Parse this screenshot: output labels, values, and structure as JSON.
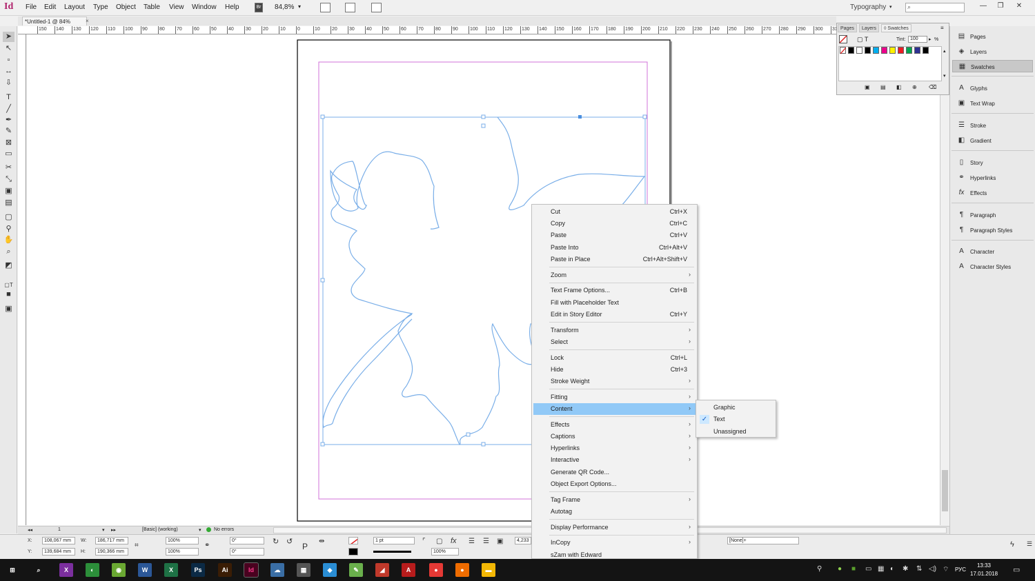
{
  "app": {
    "logo": "Id",
    "menu": [
      "File",
      "Edit",
      "Layout",
      "Type",
      "Object",
      "Table",
      "View",
      "Window",
      "Help"
    ],
    "bridge_label": "Br",
    "zoom": "84,8%",
    "workspace": "Typography",
    "window_controls": [
      "—",
      "❐",
      "✕"
    ]
  },
  "document": {
    "tab_title": "*Untitled-1 @ 84%",
    "tab_close": "×"
  },
  "ruler_top_labels": [
    "150",
    "140",
    "130",
    "120",
    "110",
    "100",
    "90",
    "80",
    "70",
    "60",
    "50",
    "40",
    "30",
    "20",
    "10",
    "0",
    "10",
    "20",
    "30",
    "40",
    "50",
    "60",
    "70",
    "80",
    "90",
    "100",
    "110",
    "120",
    "130",
    "140",
    "150",
    "160",
    "170",
    "180",
    "190",
    "200",
    "210",
    "220",
    "230",
    "240",
    "250",
    "260",
    "270",
    "280",
    "290",
    "300",
    "310"
  ],
  "swatches_panel": {
    "tabs": [
      "Pages",
      "Layers",
      "◊ Swatches"
    ],
    "tint_label": "Tint:",
    "tint_value": "100",
    "tint_unit": "%",
    "swatch_colors": [
      "#ffffff",
      "#000000",
      "#ffffff",
      "#000000",
      "#00aeef",
      "#ec008c",
      "#fff200",
      "#ed1c24",
      "#00a651",
      "#2e3192",
      "#000000"
    ],
    "footer_icons": [
      "new-group-icon",
      "show-all-icon",
      "new-swatch-icon",
      "duplicate-icon",
      "delete-icon"
    ]
  },
  "right_dock": {
    "items": [
      {
        "label": "Pages",
        "icon": "▤"
      },
      {
        "label": "Layers",
        "icon": "◈"
      },
      {
        "label": "Swatches",
        "icon": "▦",
        "active": true
      },
      {
        "label": "Glyphs",
        "icon": "A"
      },
      {
        "label": "Text Wrap",
        "icon": "▣"
      },
      {
        "label": "Stroke",
        "icon": "☰"
      },
      {
        "label": "Gradient",
        "icon": "◧"
      },
      {
        "label": "Story",
        "icon": "▯"
      },
      {
        "label": "Hyperlinks",
        "icon": "⚭"
      },
      {
        "label": "Effects",
        "icon": "fx"
      },
      {
        "label": "Paragraph",
        "icon": "¶"
      },
      {
        "label": "Paragraph Styles",
        "icon": "¶"
      },
      {
        "label": "Character",
        "icon": "A"
      },
      {
        "label": "Character Styles",
        "icon": "A"
      }
    ]
  },
  "context_menu": {
    "items": [
      {
        "label": "Cut",
        "shortcut": "Ctrl+X"
      },
      {
        "label": "Copy",
        "shortcut": "Ctrl+C"
      },
      {
        "label": "Paste",
        "shortcut": "Ctrl+V"
      },
      {
        "label": "Paste Into",
        "shortcut": "Ctrl+Alt+V"
      },
      {
        "label": "Paste in Place",
        "shortcut": "Ctrl+Alt+Shift+V"
      },
      {
        "label": "Zoom",
        "submenu": true
      },
      {
        "label": "Text Frame Options...",
        "shortcut": "Ctrl+B"
      },
      {
        "label": "Fill with Placeholder Text"
      },
      {
        "label": "Edit in Story Editor",
        "shortcut": "Ctrl+Y"
      },
      {
        "label": "Transform",
        "submenu": true
      },
      {
        "label": "Select",
        "submenu": true
      },
      {
        "label": "Lock",
        "shortcut": "Ctrl+L"
      },
      {
        "label": "Hide",
        "shortcut": "Ctrl+3"
      },
      {
        "label": "Stroke Weight",
        "submenu": true
      },
      {
        "label": "Fitting",
        "submenu": true
      },
      {
        "label": "Content",
        "submenu": true,
        "highlighted": true
      },
      {
        "label": "Effects",
        "submenu": true
      },
      {
        "label": "Captions",
        "submenu": true
      },
      {
        "label": "Hyperlinks",
        "submenu": true
      },
      {
        "label": "Interactive",
        "submenu": true
      },
      {
        "label": "Generate QR Code..."
      },
      {
        "label": "Object Export Options..."
      },
      {
        "label": "Tag Frame",
        "submenu": true
      },
      {
        "label": "Autotag"
      },
      {
        "label": "Display Performance",
        "submenu": true
      },
      {
        "label": "InCopy",
        "submenu": true
      },
      {
        "label": "sZam with Edward"
      }
    ],
    "arrow": "›"
  },
  "content_submenu": {
    "items": [
      {
        "label": "Graphic",
        "checked": false
      },
      {
        "label": "Text",
        "checked": true
      },
      {
        "label": "Unassigned",
        "checked": false
      }
    ],
    "check": "✓"
  },
  "control_panel": {
    "x_label": "X:",
    "x_value": "108,067 mm",
    "y_label": "Y:",
    "y_value": "139,684 mm",
    "w_label": "W:",
    "w_value": "186,717 mm",
    "h_label": "H:",
    "h_value": "190,366 mm",
    "scale_x": "100%",
    "scale_y": "100%",
    "rotate": "0°",
    "shear": "0°",
    "stroke_weight": "1 pt",
    "opacity": "100%",
    "gutter_value": "4,233",
    "object_style": "[None]+"
  },
  "status_bar": {
    "page": "1",
    "preflight_profile": "[Basic] (working)",
    "preflight_status": "No errors"
  },
  "taskbar": {
    "apps": [
      {
        "name": "windows-start-icon",
        "label": "⊞",
        "color": "#141414"
      },
      {
        "name": "search-icon",
        "label": "⌕",
        "color": "#141414"
      },
      {
        "name": "app-icon-1",
        "label": "X",
        "color": "#7b2f9e"
      },
      {
        "name": "app-icon-2",
        "label": "◐",
        "color": "#2c8f3a"
      },
      {
        "name": "app-icon-3",
        "label": "◉",
        "color": "#6aa832"
      },
      {
        "name": "word-icon",
        "label": "W",
        "color": "#2b5797"
      },
      {
        "name": "excel-icon",
        "label": "X",
        "color": "#1e7145"
      },
      {
        "name": "photoshop-icon",
        "label": "Ps",
        "color": "#0b2a45"
      },
      {
        "name": "illustrator-icon",
        "label": "Ai",
        "color": "#3a1d05"
      },
      {
        "name": "indesign-icon",
        "label": "Id",
        "color": "#49021f"
      },
      {
        "name": "app-icon-4",
        "label": "☁",
        "color": "#3a6ea5"
      },
      {
        "name": "calculator-icon",
        "label": "▦",
        "color": "#555555"
      },
      {
        "name": "app-icon-5",
        "label": "◆",
        "color": "#2a8dd4"
      },
      {
        "name": "app-icon-6",
        "label": "✎",
        "color": "#6ab04c"
      },
      {
        "name": "pdf-icon",
        "label": "◢",
        "color": "#c0392b"
      },
      {
        "name": "acrobat-icon",
        "label": "A",
        "color": "#b71c1c"
      },
      {
        "name": "chrome-icon",
        "label": "●",
        "color": "#e53935"
      },
      {
        "name": "firefox-icon",
        "label": "●",
        "color": "#ef6c00"
      },
      {
        "name": "explorer-icon",
        "label": "▬",
        "color": "#f2b705"
      }
    ],
    "language": "РУС",
    "time": "13:33",
    "date": "17.01.2018"
  },
  "colors": {
    "accent_highlight": "#91c9f7",
    "frame_outline": "#79aee8",
    "margin_guide": "#d070d8"
  }
}
